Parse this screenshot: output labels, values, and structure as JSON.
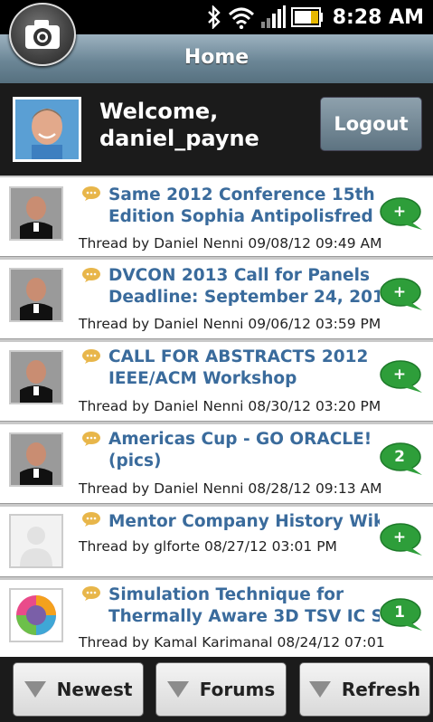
{
  "status_bar": {
    "time": "8:28 AM",
    "icons": [
      "bluetooth-icon",
      "wifi-icon",
      "signal-icon",
      "battery-icon"
    ]
  },
  "header": {
    "title": "Home",
    "camera_icon": "camera-icon"
  },
  "welcome": {
    "line1": "Welcome,",
    "line2": "daniel_payne",
    "logout_label": "Logout"
  },
  "threads": [
    {
      "title_line1": "Same 2012 Conference 15th",
      "title_line2": "Edition Sophia Antipolisfred ...",
      "meta": "Thread by Daniel Nenni 09/08/12 09:49 AM",
      "badge": "+"
    },
    {
      "title_line1": "DVCON 2013 Call for Panels",
      "title_line2": "Deadline: September 24, 201...",
      "meta": "Thread by Daniel Nenni 09/06/12 03:59 PM",
      "badge": "+"
    },
    {
      "title_line1": "CALL FOR ABSTRACTS 2012",
      "title_line2": "IEEE/ACM Workshop",
      "meta": "Thread by Daniel Nenni 08/30/12 03:20 PM",
      "badge": "+"
    },
    {
      "title_line1": "Americas Cup - GO ORACLE!",
      "title_line2": "(pics)",
      "meta": "Thread by Daniel Nenni 08/28/12 09:13 AM",
      "badge": "2"
    },
    {
      "title_line1": "Mentor Company History Wiki",
      "title_line2": "",
      "meta": "Thread by glforte 08/27/12 03:01 PM",
      "badge": "+"
    },
    {
      "title_line1": "Simulation Technique for",
      "title_line2": "Thermally Aware 3D TSV IC S...",
      "meta": "Thread by Kamal Karimanal 08/24/12 07:01",
      "badge": "1"
    }
  ],
  "bottom_bar": {
    "newest_label": "Newest",
    "forums_label": "Forums",
    "refresh_label": "Refresh"
  },
  "colors": {
    "link_blue": "#3a6b9c",
    "bubble_green": "#2e9e3a",
    "header_steel": "#6b8696"
  }
}
